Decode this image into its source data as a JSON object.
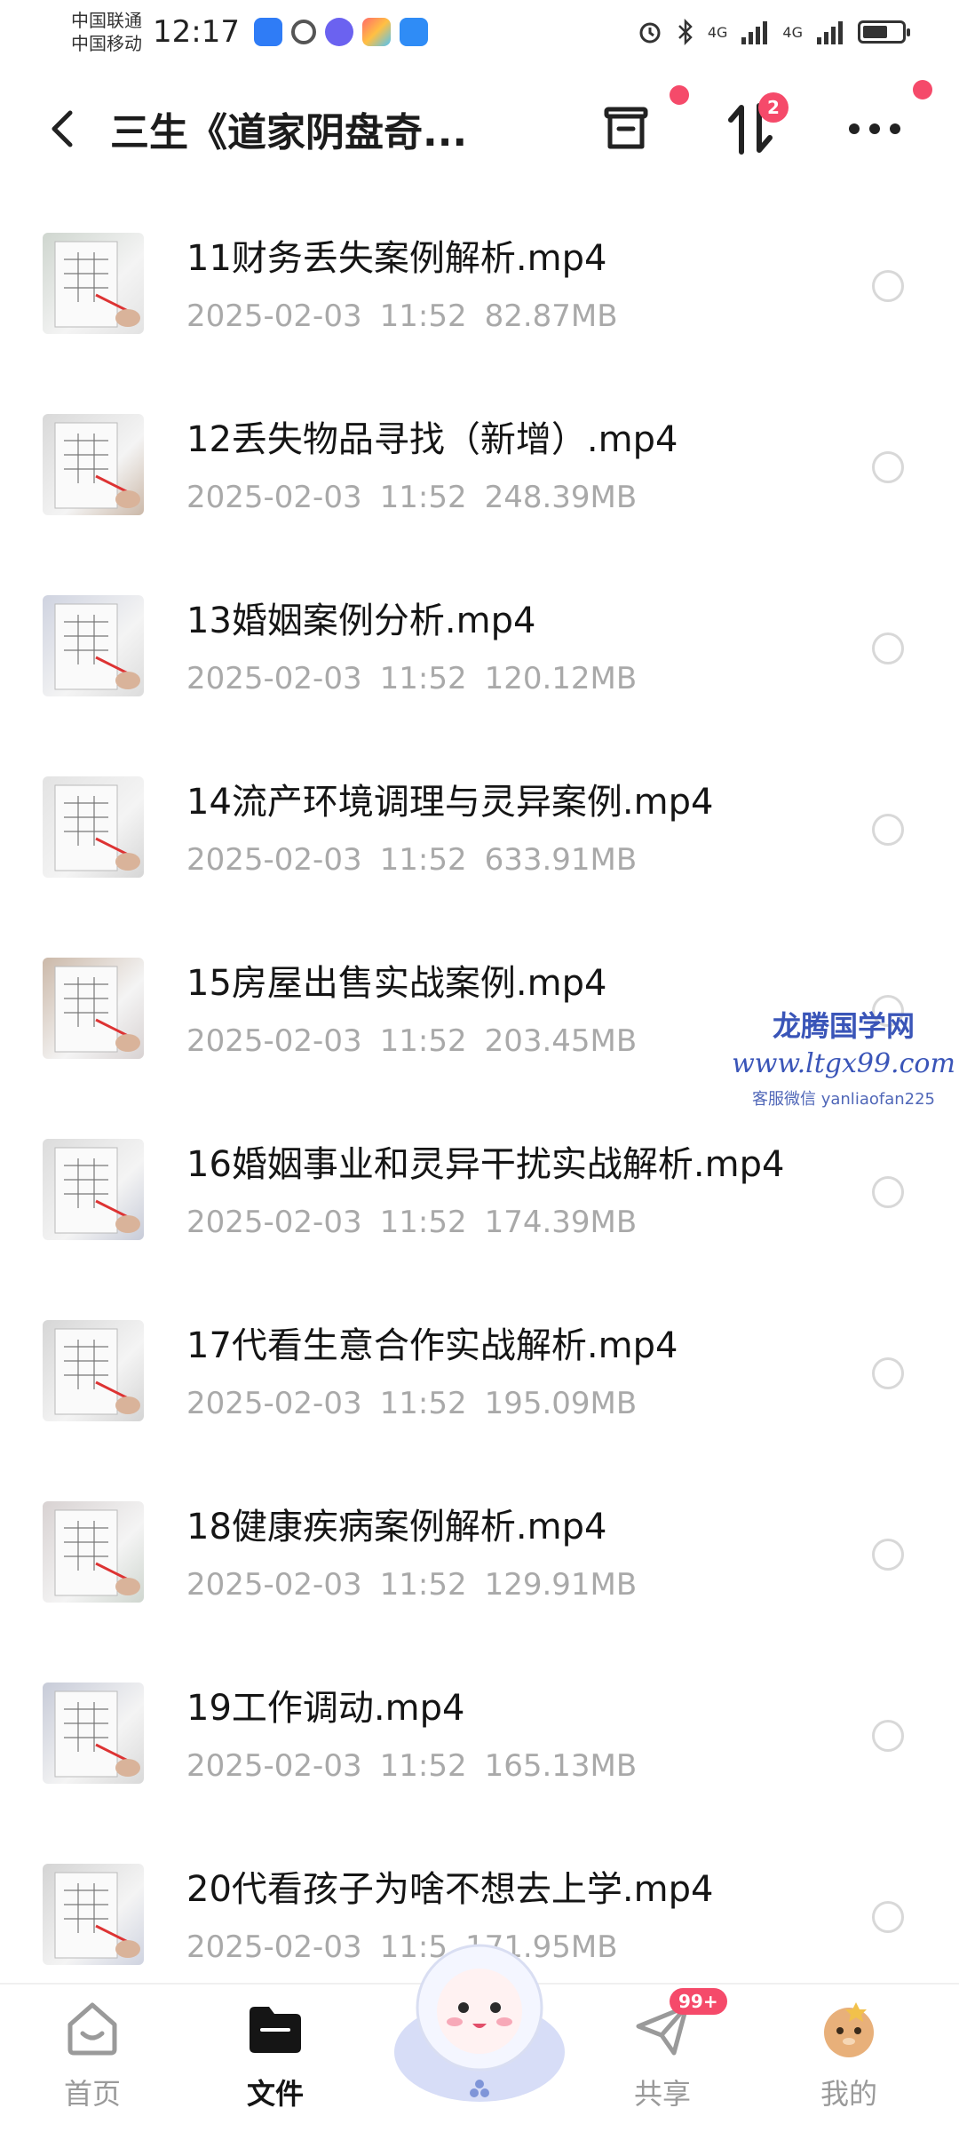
{
  "status_bar": {
    "carrier_1": "中国联通",
    "carrier_2": "中国移动",
    "time": "12:17",
    "network_1": "4G",
    "network_2": "4G",
    "battery_level": 0.65
  },
  "header": {
    "title": "三生《道家阴盘奇...",
    "sort_badge_count": "2"
  },
  "files": [
    {
      "name": "11财务丢失案例解析.mp4",
      "date": "2025-02-03",
      "time": "11:52",
      "size": "82.87MB"
    },
    {
      "name": "12丢失物品寻找（新增）.mp4",
      "date": "2025-02-03",
      "time": "11:52",
      "size": "248.39MB"
    },
    {
      "name": "13婚姻案例分析.mp4",
      "date": "2025-02-03",
      "time": "11:52",
      "size": "120.12MB"
    },
    {
      "name": "14流产环境调理与灵异案例.mp4",
      "date": "2025-02-03",
      "time": "11:52",
      "size": "633.91MB"
    },
    {
      "name": "15房屋出售实战案例.mp4",
      "date": "2025-02-03",
      "time": "11:52",
      "size": "203.45MB"
    },
    {
      "name": "16婚姻事业和灵异干扰实战解析.mp4",
      "date": "2025-02-03",
      "time": "11:52",
      "size": "174.39MB"
    },
    {
      "name": "17代看生意合作实战解析.mp4",
      "date": "2025-02-03",
      "time": "11:52",
      "size": "195.09MB"
    },
    {
      "name": "18健康疾病案例解析.mp4",
      "date": "2025-02-03",
      "time": "11:52",
      "size": "129.91MB"
    },
    {
      "name": "19工作调动.mp4",
      "date": "2025-02-03",
      "time": "11:52",
      "size": "165.13MB"
    },
    {
      "name": "20代看孩子为啥不想去上学.mp4",
      "date": "2025-02-03",
      "time": "11:5",
      "size": "171.95MB"
    }
  ],
  "watermark": {
    "title": "龙腾国学网",
    "url": "www.ltgx99.com",
    "contact": "客服微信 yanliaofan225"
  },
  "bottom_nav": {
    "home_label": "首页",
    "files_label": "文件",
    "share_label": "共享",
    "share_badge": "99+",
    "mine_label": "我的"
  },
  "colors": {
    "accent_red": "#f54a6a",
    "text_primary": "#151515",
    "text_secondary": "#a9a9a9",
    "watermark_blue": "#3a55b8"
  }
}
